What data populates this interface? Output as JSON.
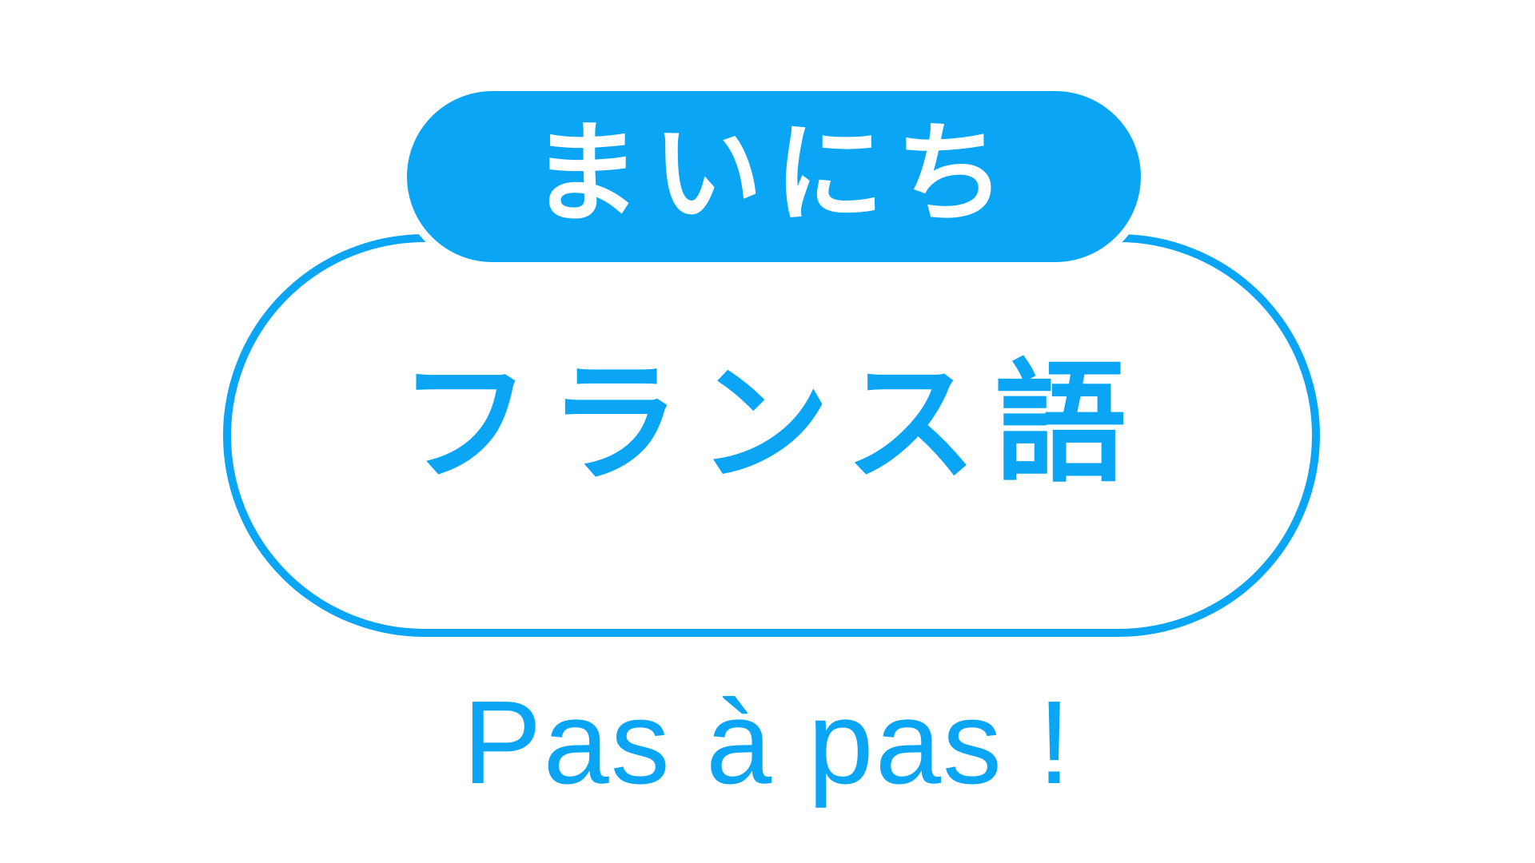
{
  "logo": {
    "top_text": "まいにち",
    "main_text": "フランス語",
    "tagline": "Pas à pas !"
  },
  "colors": {
    "accent": "#0aa6f5",
    "background": "#ffffff",
    "top_text": "#ffffff"
  }
}
